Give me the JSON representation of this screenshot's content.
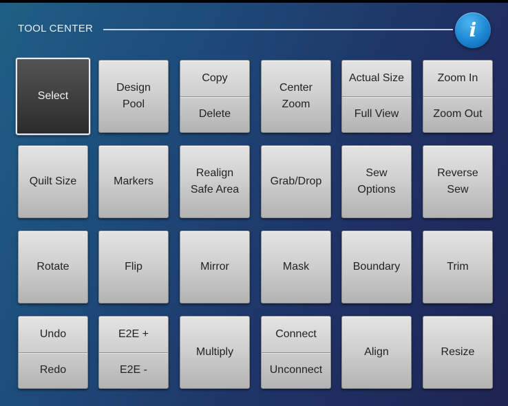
{
  "header": {
    "title": "TOOL CENTER",
    "info_icon": "i"
  },
  "buttons": {
    "select": "Select",
    "design_pool": "Design\nPool",
    "copy": "Copy",
    "delete": "Delete",
    "center_zoom": "Center\nZoom",
    "actual_size": "Actual Size",
    "full_view": "Full View",
    "zoom_in": "Zoom In",
    "zoom_out": "Zoom Out",
    "quilt_size": "Quilt Size",
    "markers": "Markers",
    "realign_safe_area": "Realign\nSafe Area",
    "grab_drop": "Grab/Drop",
    "sew_options": "Sew\nOptions",
    "reverse_sew": "Reverse\nSew",
    "rotate": "Rotate",
    "flip": "Flip",
    "mirror": "Mirror",
    "mask": "Mask",
    "boundary": "Boundary",
    "trim": "Trim",
    "undo": "Undo",
    "redo": "Redo",
    "e2e_plus": "E2E +",
    "e2e_minus": "E2E -",
    "multiply": "Multiply",
    "connect": "Connect",
    "unconnect": "Unconnect",
    "align": "Align",
    "resize": "Resize"
  },
  "colors": {
    "accent": "#1b86d2",
    "selected_button": "#3e3e3e",
    "button_face": "#d0d0d0"
  }
}
